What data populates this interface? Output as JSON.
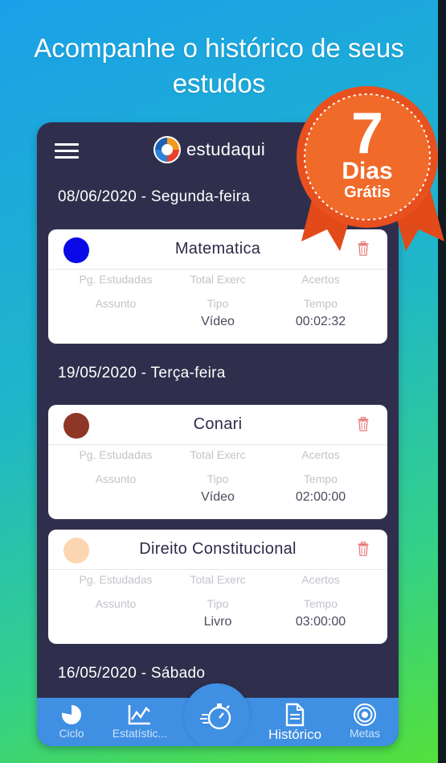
{
  "promo": {
    "headline": "Acompanhe o histórico de seus estudos",
    "badge_number": "7",
    "badge_line1": "Dias",
    "badge_line2": "Grátis"
  },
  "app": {
    "logo_text": "estudaqui",
    "menu_icon": "hamburger-menu-icon"
  },
  "field_labels": {
    "pages": "Pg. Estudadas",
    "exercises": "Total Exerc",
    "correct": "Acertos",
    "subject": "Assunto",
    "type": "Tipo",
    "time": "Tempo"
  },
  "sections": [
    {
      "date": "08/06/2020 - Segunda-feira",
      "entries": [
        {
          "subject": "Matematica",
          "color": "#0a0ae6",
          "type": "Vídeo",
          "time": "00:02:32"
        }
      ]
    },
    {
      "date": "19/05/2020 - Terça-feira",
      "entries": [
        {
          "subject": "Conari",
          "color": "#8e3727",
          "type": "Vídeo",
          "time": "02:00:00"
        },
        {
          "subject": "Direito Constitucional",
          "color": "#fcd6b0",
          "type": "Livro",
          "time": "03:00:00"
        }
      ]
    },
    {
      "date": "16/05/2020 - Sábado",
      "entries": []
    }
  ],
  "nav": {
    "tabs": [
      {
        "label": "Ciclo",
        "icon": "pie-chart-icon"
      },
      {
        "label": "Estatístic...",
        "icon": "line-chart-icon"
      },
      {
        "label": "Histórico",
        "icon": "document-icon",
        "active": true
      },
      {
        "label": "Metas",
        "icon": "target-icon"
      }
    ],
    "center_icon": "stopwatch-icon"
  },
  "colors": {
    "app_background": "#2f2f4d",
    "nav_bar": "#3f8fe3",
    "badge": "#e8501e",
    "trash": "#e57373"
  }
}
